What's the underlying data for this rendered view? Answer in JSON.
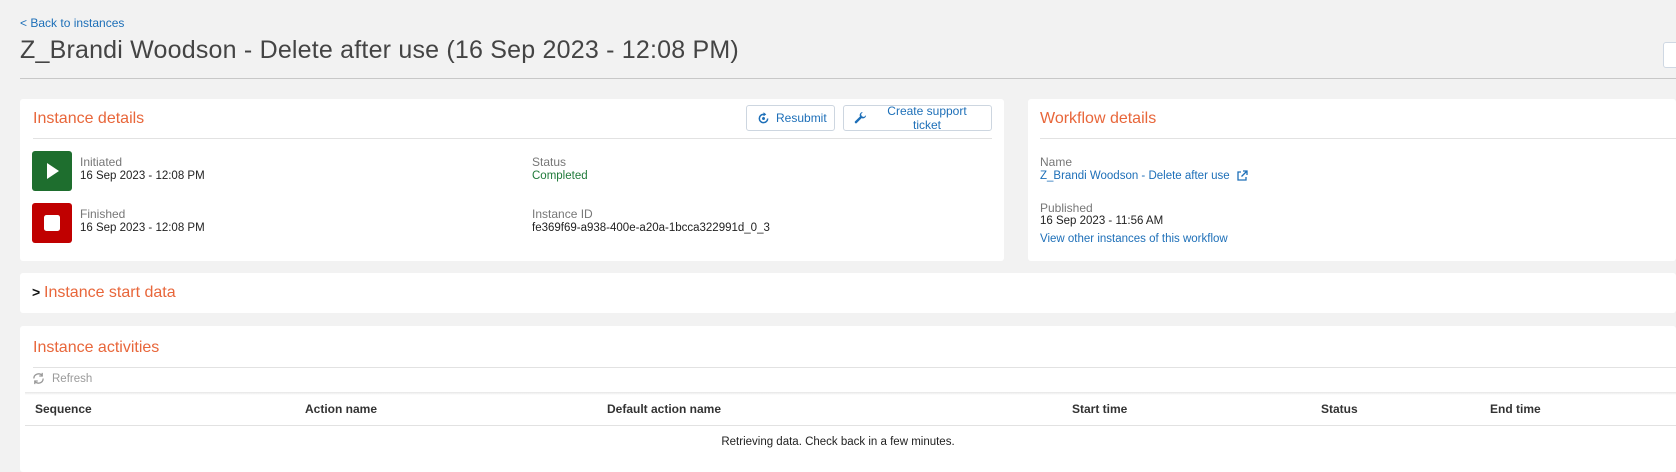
{
  "nav": {
    "back_label": "< Back to instances"
  },
  "page": {
    "title": "Z_Brandi Woodson - Delete after use (16 Sep 2023 - 12:08 PM)"
  },
  "instance_details": {
    "title": "Instance details",
    "resubmit_label": "Resubmit",
    "support_label": "Create support ticket",
    "initiated_label": "Initiated",
    "initiated_value": "16 Sep 2023 - 12:08 PM",
    "finished_label": "Finished",
    "finished_value": "16 Sep 2023 - 12:08 PM",
    "status_label": "Status",
    "status_value": "Completed",
    "instance_id_label": "Instance ID",
    "instance_id_value": "fe369f69-a938-400e-a20a-1bcca322991d_0_3",
    "colors": {
      "started": "#1e6e2e",
      "finished": "#c00000",
      "completed": "#1f7a3a"
    }
  },
  "workflow_details": {
    "title": "Workflow details",
    "name_label": "Name",
    "name_value": "Z_Brandi Woodson - Delete after use",
    "published_label": "Published",
    "published_value": "16 Sep 2023 - 11:56 AM",
    "other_instances_label": "View other instances of this workflow"
  },
  "start_data": {
    "title": "Instance start data",
    "collapsed_indicator": ">"
  },
  "activities": {
    "title": "Instance activities",
    "refresh_label": "Refresh",
    "columns": [
      "Sequence",
      "Action name",
      "Default action name",
      "Start time",
      "Status",
      "End time"
    ],
    "empty_message": "Retrieving data. Check back in a few minutes."
  },
  "theme": {
    "accent": "#e8663a",
    "link": "#1d6fb8"
  },
  "icons": [
    "resubmit-icon",
    "wrench-icon",
    "play-icon",
    "stop-icon",
    "external-link-icon",
    "refresh-icon"
  ]
}
